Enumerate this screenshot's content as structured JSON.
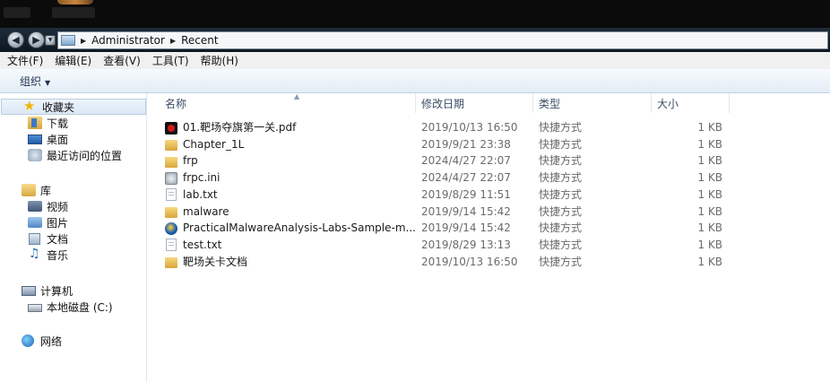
{
  "address": {
    "segments": [
      "Administrator",
      "Recent"
    ]
  },
  "menu": [
    "文件(F)",
    "编辑(E)",
    "查看(V)",
    "工具(T)",
    "帮助(H)"
  ],
  "toolbar": {
    "organize": "组织"
  },
  "nav": {
    "favorites": {
      "label": "收藏夹",
      "items": [
        {
          "label": "下载",
          "icon": "download-folder-icon"
        },
        {
          "label": "桌面",
          "icon": "desktop-icon"
        },
        {
          "label": "最近访问的位置",
          "icon": "recent-places-icon"
        }
      ]
    },
    "libraries": {
      "label": "库",
      "items": [
        {
          "label": "视频",
          "icon": "video-library-icon"
        },
        {
          "label": "图片",
          "icon": "pictures-library-icon"
        },
        {
          "label": "文档",
          "icon": "documents-library-icon"
        },
        {
          "label": "音乐",
          "icon": "music-library-icon"
        }
      ]
    },
    "computer": {
      "label": "计算机",
      "items": [
        {
          "label": "本地磁盘 (C:)",
          "icon": "local-disk-icon"
        }
      ]
    },
    "network": {
      "label": "网络"
    }
  },
  "columns": {
    "name": "名称",
    "date": "修改日期",
    "type": "类型",
    "size": "大小"
  },
  "files": [
    {
      "name": "01.靶场夺旗第一关.pdf",
      "date": "2019/10/13 16:50",
      "type": "快捷方式",
      "size": "1 KB",
      "icon": "pdf-icon"
    },
    {
      "name": "Chapter_1L",
      "date": "2019/9/21 23:38",
      "type": "快捷方式",
      "size": "1 KB",
      "icon": "folder-icon"
    },
    {
      "name": "frp",
      "date": "2024/4/27 22:07",
      "type": "快捷方式",
      "size": "1 KB",
      "icon": "folder-icon"
    },
    {
      "name": "frpc.ini",
      "date": "2024/4/27 22:07",
      "type": "快捷方式",
      "size": "1 KB",
      "icon": "ini-file-icon"
    },
    {
      "name": "lab.txt",
      "date": "2019/8/29 11:51",
      "type": "快捷方式",
      "size": "1 KB",
      "icon": "text-file-icon"
    },
    {
      "name": "malware",
      "date": "2019/9/14 15:42",
      "type": "快捷方式",
      "size": "1 KB",
      "icon": "folder-icon"
    },
    {
      "name": "PracticalMalwareAnalysis-Labs-Sample-m...",
      "date": "2019/9/14 15:42",
      "type": "快捷方式",
      "size": "1 KB",
      "icon": "installer-icon"
    },
    {
      "name": "test.txt",
      "date": "2019/8/29 13:13",
      "type": "快捷方式",
      "size": "1 KB",
      "icon": "text-file-icon"
    },
    {
      "name": "靶场关卡文档",
      "date": "2019/10/13 16:50",
      "type": "快捷方式",
      "size": "1 KB",
      "icon": "folder-icon"
    }
  ]
}
